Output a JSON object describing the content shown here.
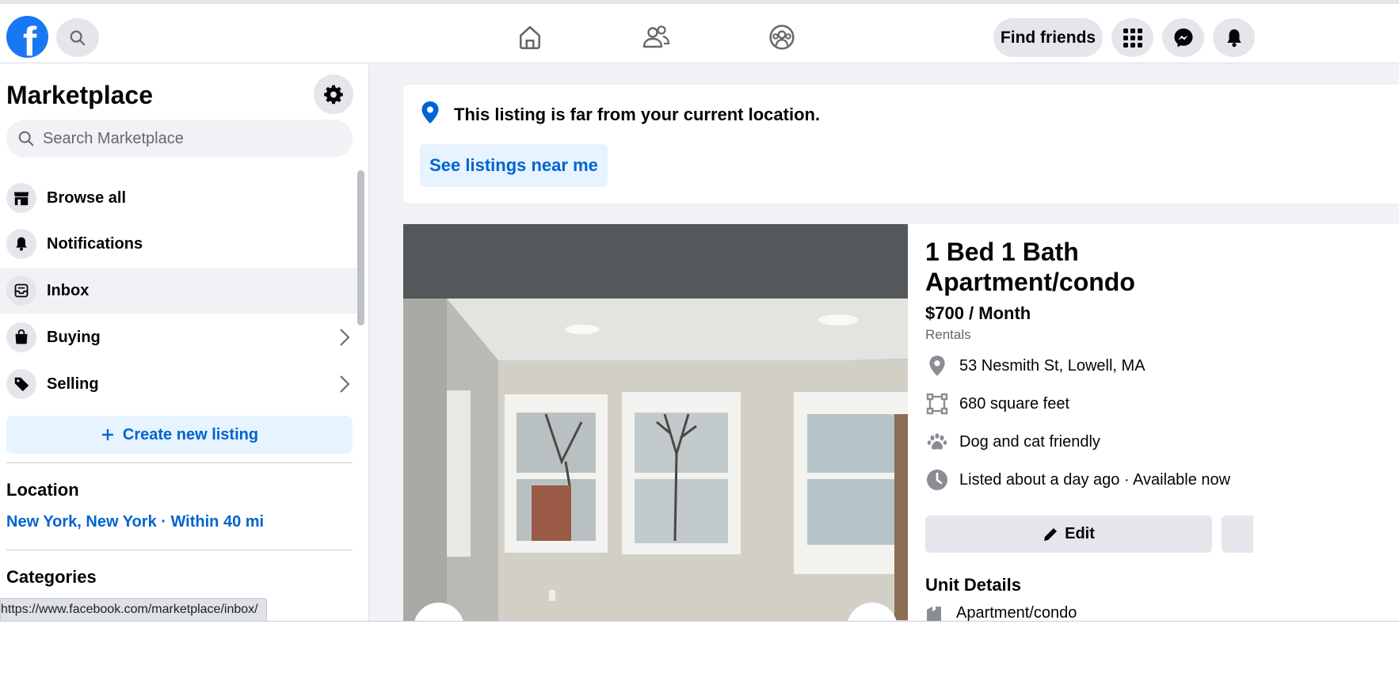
{
  "header": {
    "logo_letter": "f",
    "find_friends_label": "Find friends"
  },
  "sidebar": {
    "title": "Marketplace",
    "search_placeholder": "Search Marketplace",
    "items": [
      {
        "label": "Browse all",
        "icon": "storefront-icon"
      },
      {
        "label": "Notifications",
        "icon": "bell-icon"
      },
      {
        "label": "Inbox",
        "icon": "inbox-icon",
        "active": true
      },
      {
        "label": "Buying",
        "icon": "shopping-bag-icon",
        "chevron": true
      },
      {
        "label": "Selling",
        "icon": "price-tag-icon",
        "chevron": true
      }
    ],
    "create_label": "Create new listing",
    "location_heading": "Location",
    "location_value": "New York, New York · Within 40 mi",
    "categories_heading": "Categories"
  },
  "status_bar": {
    "url": "https://www.facebook.com/marketplace/inbox/"
  },
  "notice": {
    "text": "This listing is far from your current location.",
    "button_label": "See listings near me"
  },
  "listing": {
    "title": "1 Bed 1 Bath Apartment/condo",
    "price": "$700 / Month",
    "category": "Rentals",
    "address": "53 Nesmith St, Lowell, MA",
    "size": "680 square feet",
    "pets": "Dog and cat friendly",
    "listed": "Listed about a day ago · Available now",
    "edit_label": "Edit",
    "unit_details_heading": "Unit Details",
    "unit_type": "Apartment/condo"
  },
  "colors": {
    "brand": "#1877f2",
    "link": "#0064d1",
    "light_blue": "#e7f3ff",
    "gray_button": "#e4e6eb"
  }
}
